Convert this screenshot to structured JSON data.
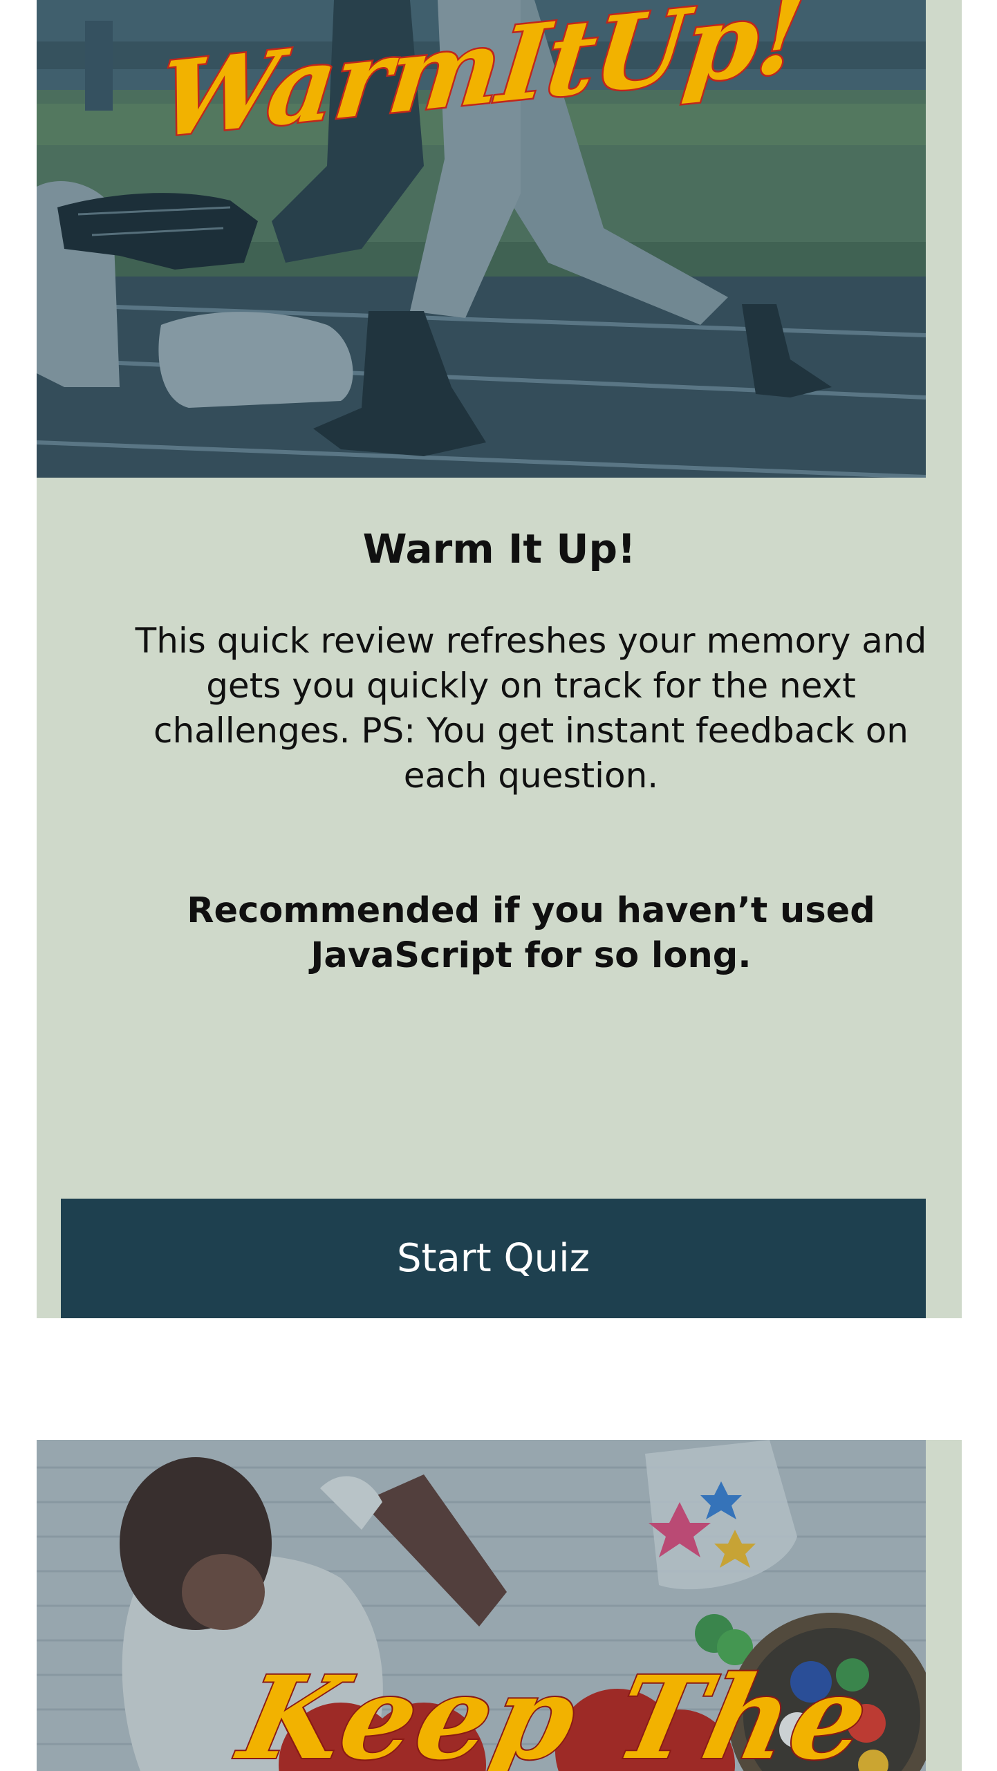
{
  "quizzes": [
    {
      "banner_text": "WarmItUp!",
      "title": "Warm It Up!",
      "description": "This quick review refreshes your memory and gets you quickly on track for the next challenges. PS: You get instant feedback on each question.",
      "note": "Recommended if you haven’t used JavaScript for so long.",
      "button_label": "Start Quiz"
    },
    {
      "banner_text": "Keep The"
    }
  ],
  "colors": {
    "card_background": "#cfd9ca",
    "button_background": "#1e404f",
    "banner_text_fill": "#f2b200",
    "banner_text_outline": "#c0261c"
  }
}
